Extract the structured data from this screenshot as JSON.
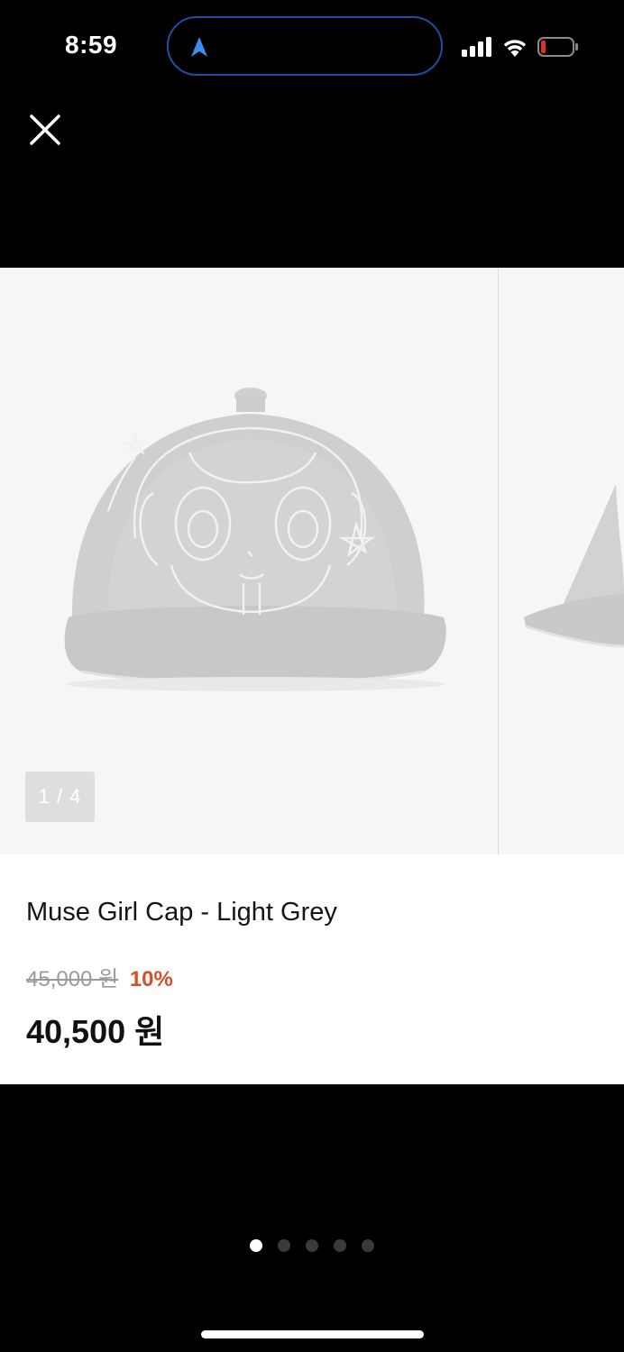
{
  "status_bar": {
    "time": "8:59",
    "icons": [
      "navigation-arrow-icon",
      "cellular-signal-icon",
      "wifi-icon",
      "battery-low-icon"
    ]
  },
  "header": {
    "close_icon": "close-icon"
  },
  "product": {
    "image_counter": "1 / 4",
    "image_description_icons": [
      "cap-image"
    ],
    "title": "Muse Girl Cap - Light Grey",
    "original_price": "45,000 원",
    "discount": "10%",
    "sale_price": "40,500 원"
  },
  "pagination": {
    "total": 5,
    "current": 1
  },
  "colors": {
    "background": "#000000",
    "card": "#ffffff",
    "image_bg": "#f6f6f6",
    "discount": "#d0502a",
    "island_border": "#1f4fa0",
    "nav_arrow": "#3b8ef0",
    "battery_low": "#e0302a"
  }
}
